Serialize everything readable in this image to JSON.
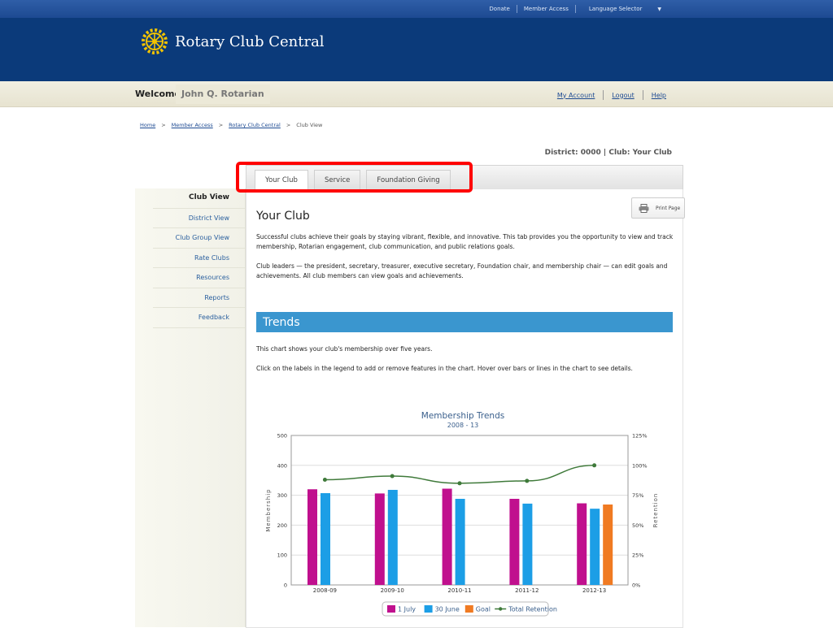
{
  "utility_nav": {
    "donate": "Donate",
    "member_access": "Member Access",
    "language": "Language Selector"
  },
  "brand": {
    "name": "Rotary Club Central"
  },
  "welcome": {
    "label": "Welcome",
    "user": "John Q. Rotarian"
  },
  "account_links": {
    "my_account": "My Account",
    "logout": "Logout",
    "help": "Help"
  },
  "breadcrumb": [
    {
      "label": "Home",
      "sep": ">"
    },
    {
      "label": "Member Access",
      "sep": ">"
    },
    {
      "label": "Rotary Club Central",
      "sep": ">"
    },
    {
      "label": "Club View"
    }
  ],
  "district_label": "District: 0000 | Club: Your Club",
  "tabs": [
    {
      "label": "Your Club"
    },
    {
      "label": "Service"
    },
    {
      "label": "Foundation Giving"
    }
  ],
  "sidebar": {
    "items": [
      {
        "label": "Club View"
      },
      {
        "label": "District View"
      },
      {
        "label": "Club Group View"
      },
      {
        "label": "Rate Clubs"
      },
      {
        "label": "Resources"
      },
      {
        "label": "Reports"
      },
      {
        "label": "Feedback"
      }
    ]
  },
  "print_label": "Print Page",
  "content": {
    "title": "Your Club",
    "para1": "Successful clubs achieve their goals by staying vibrant, flexible, and innovative. This tab provides you the opportunity to view and track membership, Rotarian engagement, club communication, and public relations goals.",
    "para2": "Club leaders — the president, secretary, treasurer, executive secretary, Foundation chair, and membership chair — can edit goals and achievements. All club members can view goals and achievements.",
    "trends_heading": "Trends",
    "para3": "This chart shows your club's membership over five years.",
    "para4": "Click on the labels in the legend to add or remove features in the chart. Hover over bars or lines in the chart to see details."
  },
  "colors": {
    "header": "#0b3a7a",
    "accent": "#3a96cf",
    "july": "#c0108e",
    "june": "#1c9ee6",
    "goal": "#f07a22",
    "retention": "#3f7a3a"
  },
  "chart_data": {
    "type": "bar",
    "title": "Membership Trends",
    "subtitle": "2008 - 13",
    "categories": [
      "2008-09",
      "2009-10",
      "2010-11",
      "2011-12",
      "2012-13"
    ],
    "ylabel": "Membership",
    "y2label": "Retention",
    "ylim": [
      0,
      500
    ],
    "yticks": [
      "0",
      "100",
      "200",
      "300",
      "400",
      "500"
    ],
    "y2lim": [
      0,
      125
    ],
    "y2ticks": [
      "0%",
      "25%",
      "50%",
      "75%",
      "100%",
      "125%"
    ],
    "grid": true,
    "series": [
      {
        "name": "1 July",
        "kind": "bar",
        "color": "#c0108e",
        "values": [
          320,
          306,
          322,
          288,
          273
        ]
      },
      {
        "name": "30 June",
        "kind": "bar",
        "color": "#1c9ee6",
        "values": [
          307,
          318,
          288,
          272,
          255
        ]
      },
      {
        "name": "Goal",
        "kind": "bar",
        "color": "#f07a22",
        "values": [
          null,
          null,
          null,
          null,
          269
        ]
      },
      {
        "name": "Total Retention",
        "kind": "line",
        "axis": "right",
        "color": "#3f7a3a",
        "values": [
          88,
          91,
          85,
          87,
          100
        ]
      }
    ],
    "legend": "bottom"
  }
}
